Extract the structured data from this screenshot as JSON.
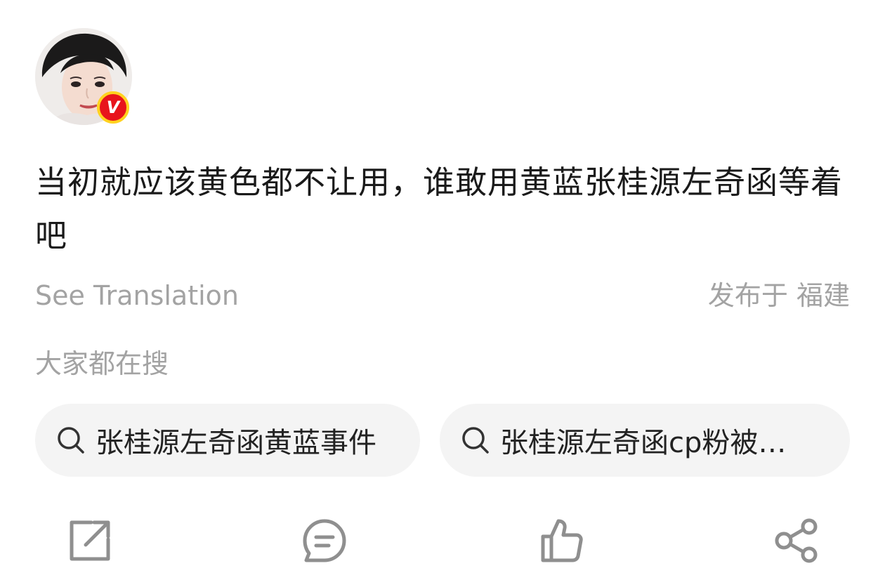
{
  "post": {
    "avatar_icon": "user-avatar",
    "verified_badge": "V",
    "text": "当初就应该黄色都不让用，谁敢用黄蓝张桂源左奇函等着吧",
    "see_translation": "See Translation",
    "location": "发布于 福建"
  },
  "related_searches": {
    "title": "大家都在搜",
    "items": [
      {
        "icon": "search-icon",
        "label": "张桂源左奇函黄蓝事件"
      },
      {
        "icon": "search-icon",
        "label": "张桂源左奇函cp粉被…"
      }
    ]
  },
  "actions": [
    {
      "icon": "share-out-icon"
    },
    {
      "icon": "comment-icon"
    },
    {
      "icon": "like-icon"
    },
    {
      "icon": "share-icon"
    }
  ],
  "colors": {
    "muted_text": "#a3a3a3",
    "chip_background": "#f4f4f4",
    "badge_red": "#e8141c",
    "badge_ring": "#ffd21f"
  }
}
